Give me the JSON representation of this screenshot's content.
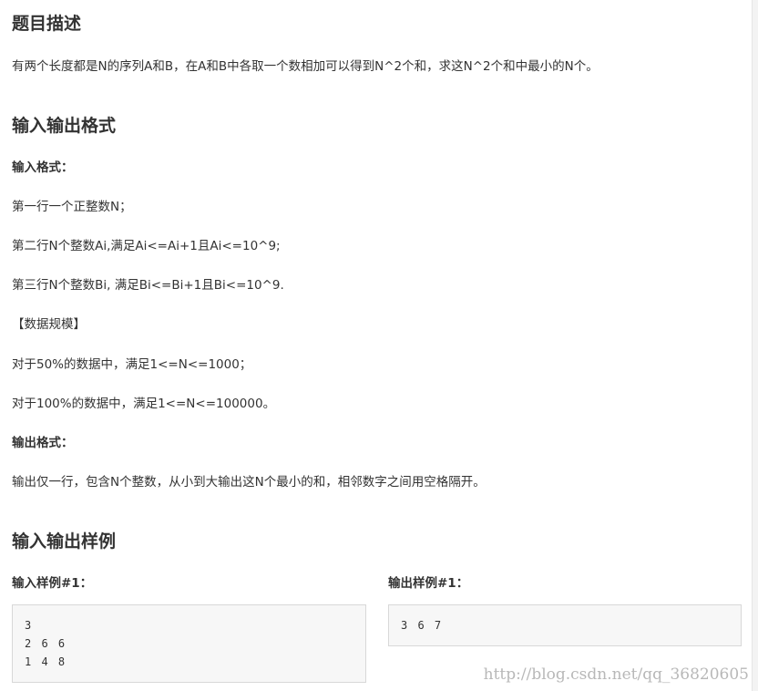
{
  "problem": {
    "desc_heading": "题目描述",
    "desc_text": "有两个长度都是N的序列A和B，在A和B中各取一个数相加可以得到N^2个和，求这N^2个和中最小的N个。",
    "io_heading": "输入输出格式",
    "input_format_label": "输入格式：",
    "input_line1": "第一行一个正整数N；",
    "input_line2": "第二行N个整数Ai,满足Ai<=Ai+1且Ai<=10^9;",
    "input_line3": "第三行N个整数Bi, 满足Bi<=Bi+1且Bi<=10^9.",
    "scale_label": "【数据规模】",
    "scale_line1": "对于50%的数据中，满足1<=N<=1000；",
    "scale_line2": "对于100%的数据中，满足1<=N<=100000。",
    "output_format_label": "输出格式：",
    "output_line1": "输出仅一行，包含N个整数，从小到大输出这N个最小的和，相邻数字之间用空格隔开。",
    "samples_heading": "输入输出样例",
    "sample_input_label": "输入样例#1：",
    "sample_input_lines": [
      "3",
      "2 6 6",
      "1 4 8"
    ],
    "sample_output_label": "输出样例#1：",
    "sample_output_lines": [
      "3 6 7"
    ]
  },
  "watermark": "http://blog.csdn.net/qq_36820605"
}
